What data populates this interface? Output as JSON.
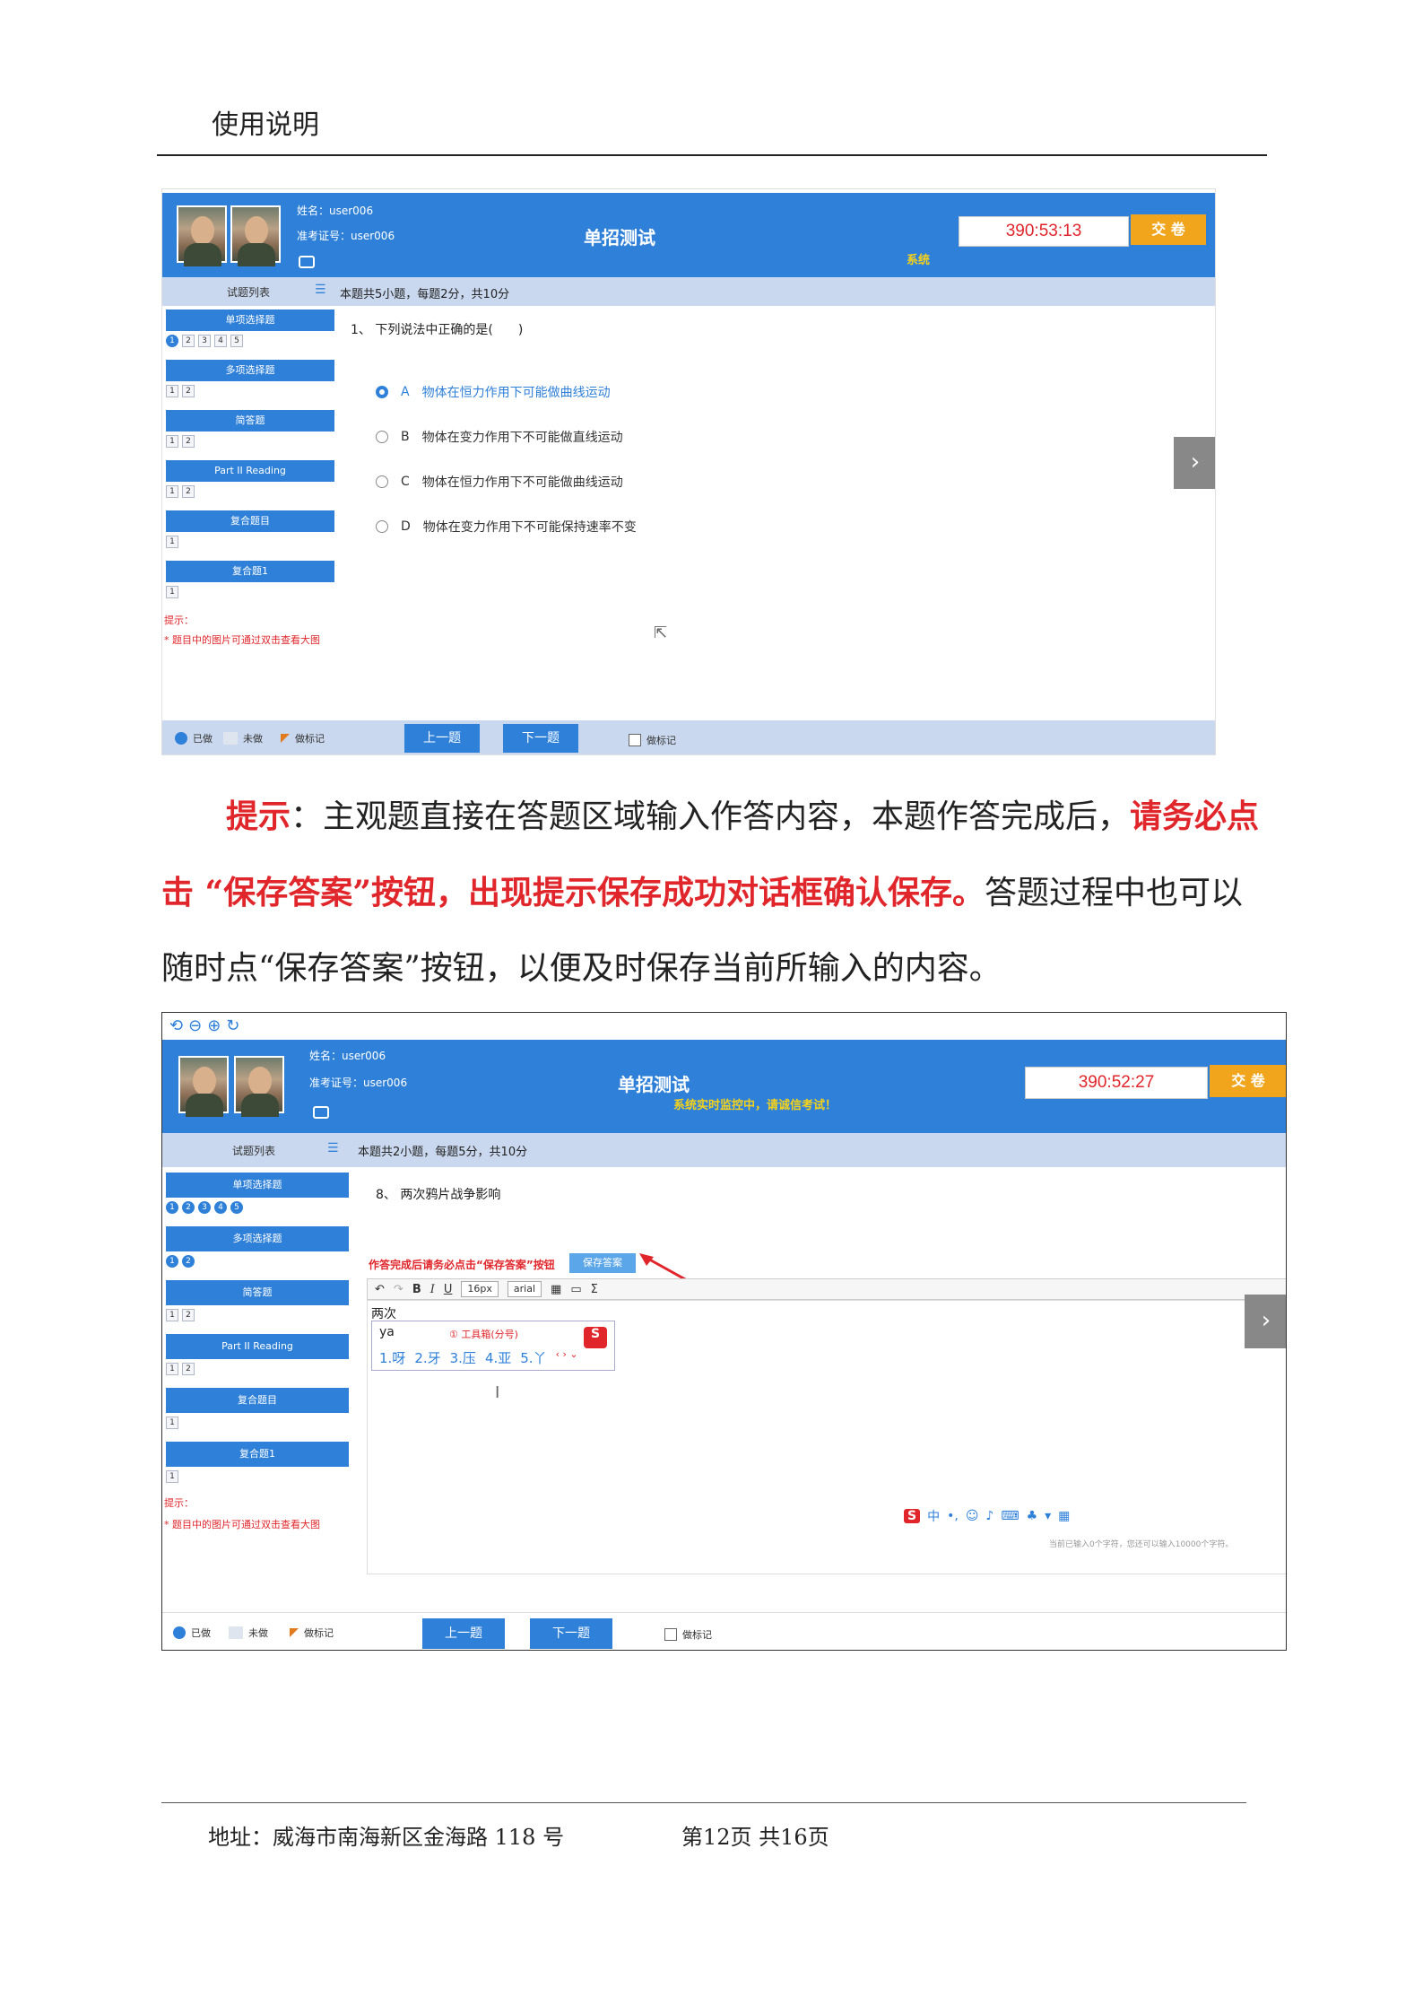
{
  "header": {
    "title": "使用说明"
  },
  "shot1": {
    "name_line": "姓名：user006",
    "ticket_line": "准考证号：user006",
    "exam_title": "单招测试",
    "timer": "390:53:13",
    "submit": "交 卷",
    "monitor": "系统",
    "question_list": "试题列表",
    "count": "本题共5小题，每题2分，共10分",
    "categories": [
      "单项选择题",
      "多项选择题",
      "简答题",
      "Part II Reading",
      "复合题目",
      "复合题1"
    ],
    "cat_nums": [
      [
        "1",
        "2",
        "3",
        "4",
        "5"
      ],
      [
        "1",
        "2"
      ],
      [
        "1",
        "2"
      ],
      [
        "1",
        "2"
      ],
      [
        "1"
      ],
      [
        "1"
      ]
    ],
    "hint_title": "提示：",
    "hint_body": "* 题目中的图片可通过双击查看大图",
    "question": "1、 下列说法中正确的是(　　)",
    "options": [
      {
        "letter": "A",
        "text": "物体在恒力作用下可能做曲线运动"
      },
      {
        "letter": "B",
        "text": "物体在变力作用下不可能做直线运动"
      },
      {
        "letter": "C",
        "text": "物体在恒力作用下不可能做曲线运动"
      },
      {
        "letter": "D",
        "text": "物体在变力作用下不可能保持速率不变"
      }
    ],
    "legend": {
      "done": "已做",
      "undone": "未做",
      "flagged": "做标记"
    },
    "prev": "上一题",
    "next": "下一题",
    "mark": "做标记"
  },
  "paragraph": {
    "lead": "提示",
    "colon": "：",
    "part1": "主观题直接在答题区域输入作答内容，本题作答完成后，",
    "red1": "请务必点击 “保存答案”按钮，出现提示保存成功对话框确认保存。",
    "part2": "答题过程中也可以随时点“保存答案”按钮，以便及时保存当前所输入的内容。"
  },
  "shot2": {
    "name_line": "姓名：user006",
    "ticket_line": "准考证号：user006",
    "exam_title": "单招测试",
    "timer": "390:52:27",
    "submit": "交 卷",
    "monitor": "系统实时监控中，请诚信考试！",
    "question_list": "试题列表",
    "count": "本题共2小题，每题5分，共10分",
    "categories": [
      "单项选择题",
      "多项选择题",
      "简答题",
      "Part II Reading",
      "复合题目",
      "复合题1"
    ],
    "cat_nums": [
      [
        "1",
        "2",
        "3",
        "4",
        "5"
      ],
      [
        "1",
        "2"
      ],
      [
        "1",
        "2"
      ],
      [
        "1",
        "2"
      ],
      [
        "1"
      ],
      [
        "1"
      ]
    ],
    "hint_title": "提示：",
    "hint_body": "* 题目中的图片可通过双击查看大图",
    "question": "8、 两次鸦片战争影响",
    "save_hint": "作答完成后请务必点击“保存答案”按钮",
    "save_button": "保存答案",
    "font_size": "16px",
    "font_family": "arial",
    "typed_text": "两次",
    "ime_input": "ya",
    "ime_tool": "① 工具箱(分号)",
    "ime_candidates": [
      "1.呀",
      "2.牙",
      "3.压",
      "4.亚",
      "5.丫"
    ],
    "char_count": "当前已输入0个字符，您还可以输入10000个字符。",
    "legend": {
      "done": "已做",
      "undone": "未做",
      "flagged": "做标记"
    },
    "prev": "上一题",
    "next": "下一题",
    "mark": "做标记"
  },
  "footer": {
    "address": "地址：威海市南海新区金海路 118 号",
    "page": "第12页  共16页"
  },
  "colors": {
    "primary": "#2f80d8",
    "accent": "#f0a51c",
    "danger": "#e0262b"
  }
}
